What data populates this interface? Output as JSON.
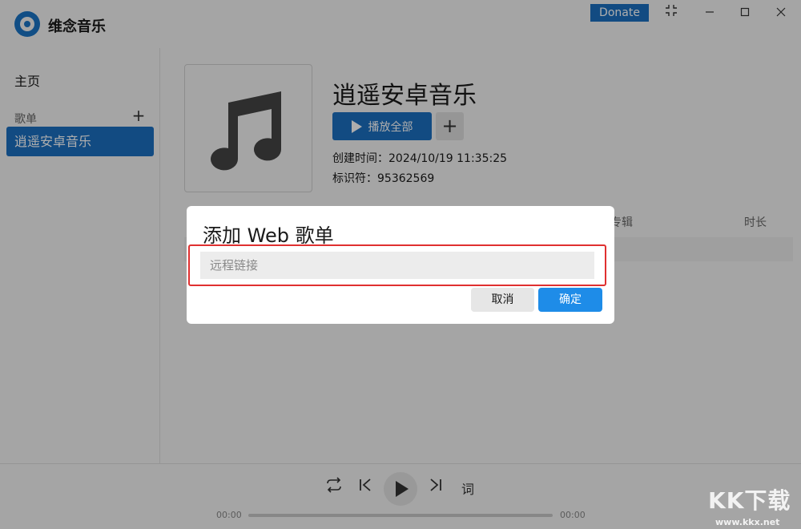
{
  "app": {
    "title": "维念音乐",
    "donate_label": "Donate"
  },
  "window_controls": {
    "fullscreen": "⛶",
    "minimize": "—",
    "maximize": "☐",
    "close": "✕"
  },
  "sidebar": {
    "home_label": "主页",
    "section_label": "歌单",
    "add_symbol": "+",
    "items": [
      {
        "label": "逍遥安卓音乐",
        "selected": true
      }
    ]
  },
  "playlist": {
    "title": "逍遥安卓音乐",
    "play_all_label": "播放全部",
    "add_symbol": "+",
    "created_label": "创建时间：2024/10/19 11:35:25",
    "id_label": "标识符：95362569",
    "cover_icon": "music-note-icon"
  },
  "table": {
    "columns": [
      {
        "label": "专辑"
      },
      {
        "label": "时长"
      }
    ]
  },
  "player": {
    "lyrics_label": "词",
    "time_current": "00:00",
    "time_total": "00:00",
    "progress": 0
  },
  "dialog": {
    "title": "添加 Web 歌单",
    "input_placeholder": "远程链接",
    "input_value": "",
    "cancel_label": "取消",
    "ok_label": "确定"
  },
  "watermark": {
    "main": "KK下载",
    "sub": "www.kkx.net"
  },
  "colors": {
    "accent": "#1b6fc0",
    "ok_button": "#1e8ce8",
    "highlight_border": "#e03030"
  }
}
